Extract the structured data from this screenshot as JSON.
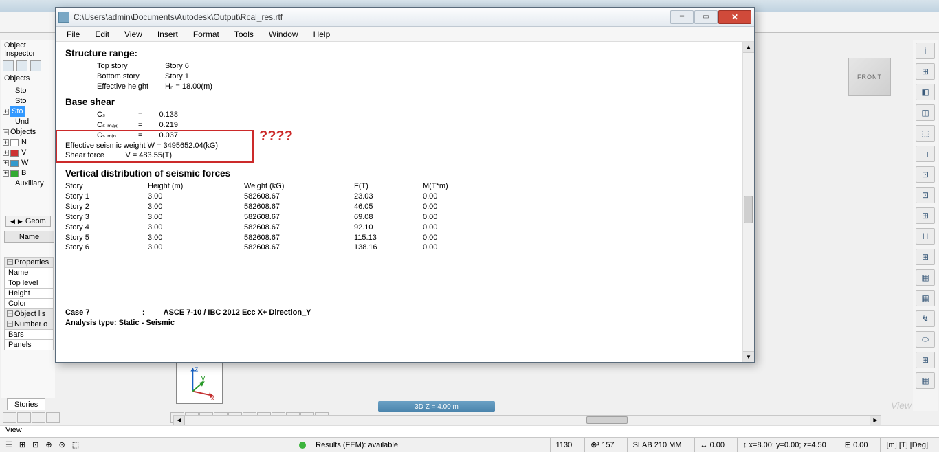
{
  "bg": {
    "obj_inspector": "Object Inspector",
    "objects_label": "Objects",
    "tree": [
      "Sto",
      "Sto",
      "Sto",
      "Und",
      "Objects",
      "N",
      "V",
      "W",
      "B",
      "Auxiliary"
    ],
    "geom_tab": "Geom",
    "name_header": "Name",
    "props_header": "Properties",
    "props_rows": [
      "Name",
      "Top level",
      "Height",
      "Color",
      "Object lis"
    ],
    "number_header": "Number o",
    "number_rows": [
      "Bars",
      "Panels"
    ],
    "stories_tab": "Stories"
  },
  "rt": [
    "i",
    "⊞",
    "◧",
    "◫",
    "⬚",
    "◻",
    "⊡",
    "⊡",
    "⊞",
    "H",
    "⊞",
    "▦",
    "▦",
    "↯",
    "⬭",
    "⊞",
    "▦"
  ],
  "modal": {
    "path": "C:\\Users\\admin\\Documents\\Autodesk\\Output\\Rcal_res.rtf",
    "menus": [
      "File",
      "Edit",
      "View",
      "Insert",
      "Format",
      "Tools",
      "Window",
      "Help"
    ],
    "structure_range": "Structure range:",
    "top_story_label": "Top story",
    "top_story_val": "Story 6",
    "bottom_story_label": "Bottom story",
    "bottom_story_val": "Story 1",
    "eff_height_label": "Effective height",
    "eff_height_val": "Hₙ = 18.00(m)",
    "base_shear": "Base shear",
    "cs_label": "Cₛ",
    "cs_val": "0.138",
    "csmax_label": "Cₛ ₘₐₓ",
    "csmax_val": "0.219",
    "csmin_label": "Cₛ ₘᵢₙ",
    "csmin_val": "0.037",
    "eff_weight": "Effective seismic weight  W = 3495652.04(kG)",
    "shear_force": "Shear force          V = 483.55(T)",
    "vert_dist": "Vertical distribution of seismic forces",
    "columns": [
      "Story",
      "Height (m)",
      "Weight (kG)",
      "F(T)",
      "M(T*m)"
    ],
    "rows": [
      [
        "Story 1",
        "3.00",
        "582608.67",
        "23.03",
        "0.00"
      ],
      [
        "Story 2",
        "3.00",
        "582608.67",
        "46.05",
        "0.00"
      ],
      [
        "Story 3",
        "3.00",
        "582608.67",
        "69.08",
        "0.00"
      ],
      [
        "Story 4",
        "3.00",
        "582608.67",
        "92.10",
        "0.00"
      ],
      [
        "Story 5",
        "3.00",
        "582608.67",
        "115.13",
        "0.00"
      ],
      [
        "Story 6",
        "3.00",
        "582608.67",
        "138.16",
        "0.00"
      ]
    ],
    "case7": "Case 7                         :         ASCE 7-10 / IBC 2012 Ecc X+ Direction_Y",
    "analysis": "Analysis type: Static - Seismic",
    "question": "????"
  },
  "view3d_label": "3D        Z = 4.00 m",
  "viewcube": "FRONT",
  "view_faint": "View",
  "status": {
    "view": "View",
    "results": "Results (FEM): available",
    "dim1": "1130",
    "cursor_label": "⊕¹",
    "dim2": "157",
    "slab": "SLAB 210 MM",
    "coord_icon": "↔",
    "coord_val": "0.00",
    "coords": "x=8.00; y=0.00; z=4.50",
    "zoom_val": "0.00",
    "units": "[m] [T] [Deg]"
  }
}
